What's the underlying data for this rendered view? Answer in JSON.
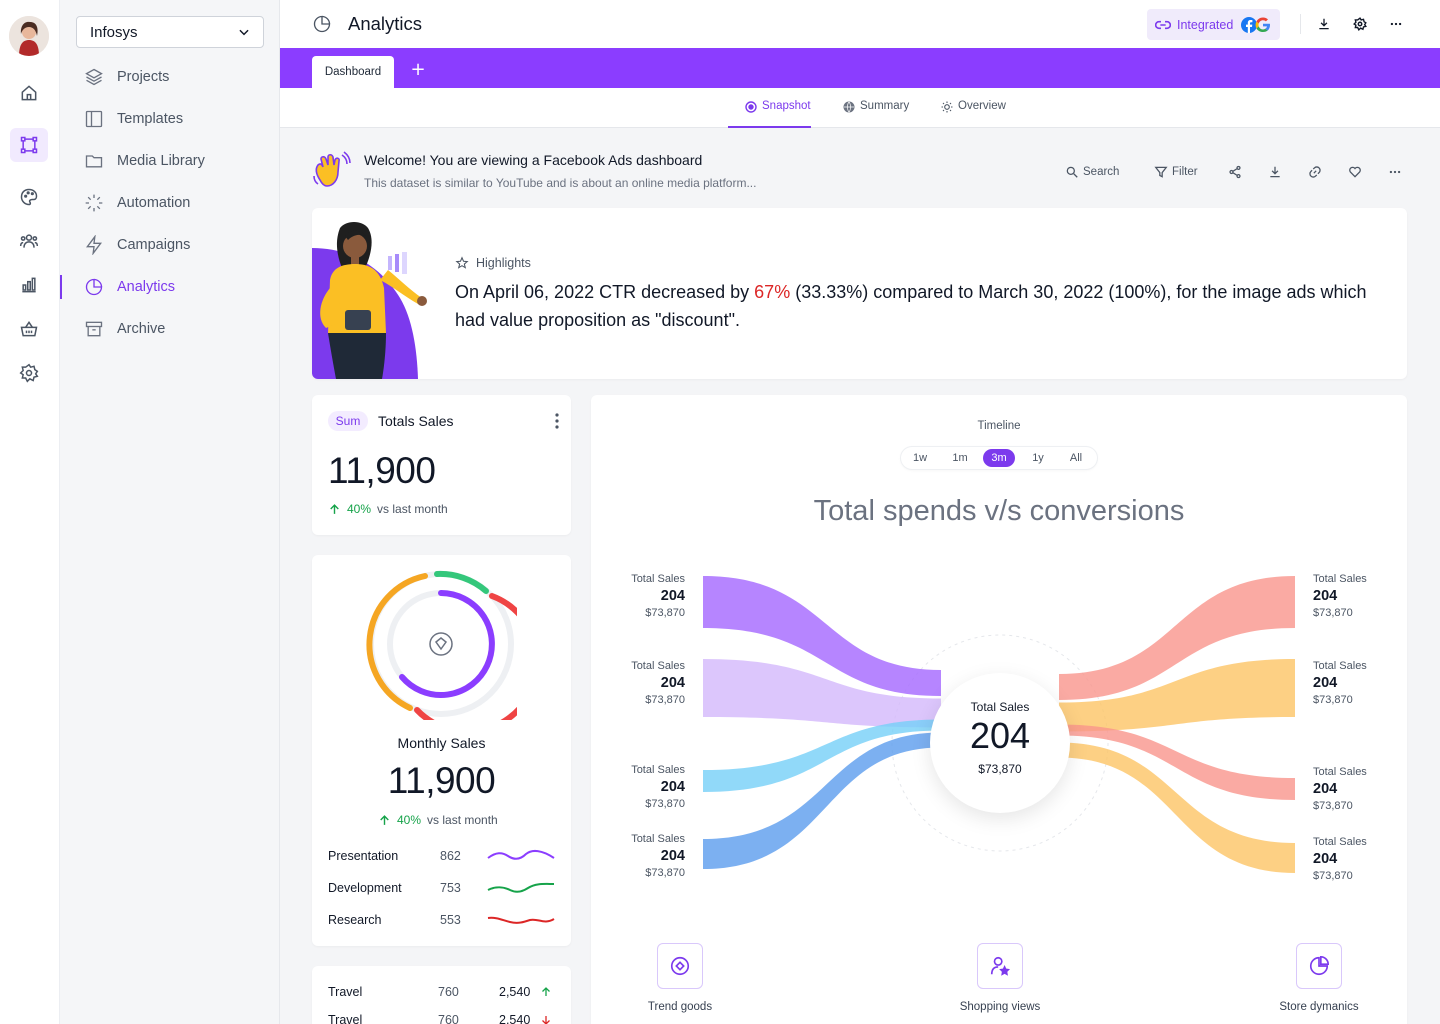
{
  "org": {
    "name": "Infosys"
  },
  "nav": {
    "items": [
      {
        "label": "Projects",
        "icon": "layers-icon"
      },
      {
        "label": "Templates",
        "icon": "layout-icon"
      },
      {
        "label": "Media Library",
        "icon": "folder-icon"
      },
      {
        "label": "Automation",
        "icon": "loader-icon"
      },
      {
        "label": "Campaigns",
        "icon": "zap-icon"
      },
      {
        "label": "Analytics",
        "icon": "pie-chart-icon",
        "active": true
      },
      {
        "label": "Archive",
        "icon": "archive-icon"
      }
    ]
  },
  "header": {
    "title": "Analytics",
    "integrated_label": "Integrated"
  },
  "tabs": {
    "active": "Dashboard",
    "add": "+"
  },
  "subtabs": [
    "Snapshot",
    "Summary",
    "Overview"
  ],
  "welcome": {
    "title": "Welcome! You are viewing a Facebook Ads dashboard",
    "subtitle": "This dataset is similar to YouTube and is about an online media platform..."
  },
  "toolbar": {
    "search": "Search",
    "filter": "Filter"
  },
  "highlights": {
    "label": "Highlights",
    "text_before": "On April 06, 2022 CTR decreased by ",
    "text_highlight": "67%",
    "text_after": " (33.33%) compared to March 30, 2022 (100%), for the image ads which had value proposition as \"discount\"."
  },
  "totals": {
    "badge": "Sum",
    "title": "Totals Sales",
    "value": "11,900",
    "delta": "40%",
    "delta_text": "vs last month"
  },
  "monthly": {
    "title": "Monthly Sales",
    "value": "11,900",
    "delta": "40%",
    "delta_text": "vs last month",
    "rows": [
      {
        "label": "Presentation",
        "value": "862",
        "color": "#8b3dff"
      },
      {
        "label": "Development",
        "value": "753",
        "color": "#16a34a"
      },
      {
        "label": "Research",
        "value": "553",
        "color": "#dc2626"
      }
    ]
  },
  "travel": {
    "rows": [
      {
        "label": "Travel",
        "v1": "760",
        "v2": "2,540",
        "trend": "up"
      },
      {
        "label": "Travel",
        "v1": "760",
        "v2": "2,540",
        "trend": "down"
      }
    ]
  },
  "timeline": {
    "label": "Timeline",
    "options": [
      "1w",
      "1m",
      "3m",
      "1y",
      "All"
    ],
    "active": "3m"
  },
  "chart_data": {
    "type": "sankey",
    "title": "Total spends v/s conversions",
    "center": {
      "label": "Total Sales",
      "value": "204",
      "amount": "$73,870"
    },
    "left_nodes": [
      {
        "label": "Total Sales",
        "value": "204",
        "amount": "$73,870",
        "color": "#a970ff"
      },
      {
        "label": "Total Sales",
        "value": "204",
        "amount": "$73,870",
        "color": "#d3b8fb"
      },
      {
        "label": "Total Sales",
        "value": "204",
        "amount": "$73,870",
        "color": "#76d0f7"
      },
      {
        "label": "Total Sales",
        "value": "204",
        "amount": "$73,870",
        "color": "#5b9cee"
      }
    ],
    "right_nodes": [
      {
        "label": "Total Sales",
        "value": "204",
        "amount": "$73,870",
        "color": "#f9958c"
      },
      {
        "label": "Total Sales",
        "value": "204",
        "amount": "$73,870",
        "color": "#fdc465"
      },
      {
        "label": "Total Sales",
        "value": "204",
        "amount": "$73,870",
        "color": "#f9958c"
      },
      {
        "label": "Total Sales",
        "value": "204",
        "amount": "$73,870",
        "color": "#fdc465"
      }
    ]
  },
  "features": [
    {
      "label": "Trend goods",
      "icon": "diamond-icon"
    },
    {
      "label": "Shopping views",
      "icon": "user-star-icon"
    },
    {
      "label": "Store dymanics",
      "icon": "pie-chart-icon"
    }
  ],
  "colors": {
    "accent": "#7c3aed",
    "tabstrip": "#8b3dff",
    "positive": "#16a34a",
    "negative": "#dc2626"
  }
}
